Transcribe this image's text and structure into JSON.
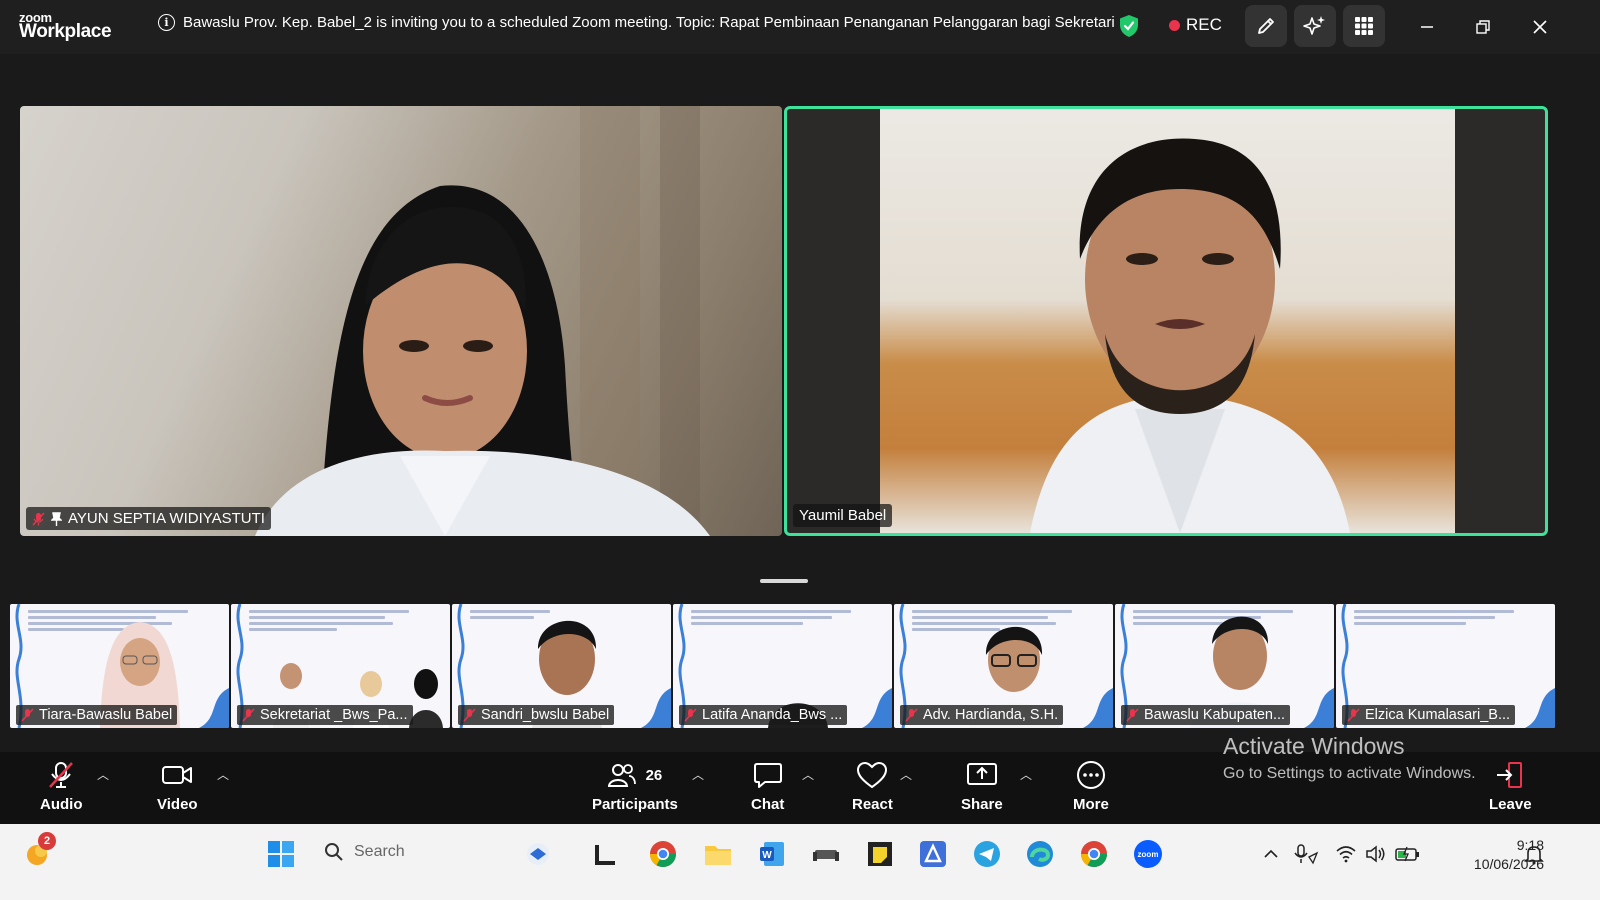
{
  "app": {
    "brand_small": "zoom",
    "brand_big": "Workplace"
  },
  "meeting": {
    "info": "Bawaslu Prov. Kep. Babel_2 is inviting you to a scheduled Zoom meeting.  Topic: Rapat Pembinaan Penanganan Pelanggaran bagi Sekretari",
    "rec_label": "REC"
  },
  "speakers": [
    {
      "name": "AYUN SEPTIA WIDIYASTUTI",
      "muted": true,
      "pinned": true
    },
    {
      "name": "Yaumil Babel",
      "muted": false,
      "pinned": false,
      "active": true
    }
  ],
  "thumbnails": [
    {
      "name": "Tiara-Bawaslu Babel"
    },
    {
      "name": "Sekretariat _Bws_Pa..."
    },
    {
      "name": "Sandri_bwslu Babel"
    },
    {
      "name": "Latifa Ananda_Bws ..."
    },
    {
      "name": "Adv. Hardianda, S.H."
    },
    {
      "name": "Bawaslu Kabupaten..."
    },
    {
      "name": "Elzica Kumalasari_B..."
    }
  ],
  "toolbar": {
    "audio": "Audio",
    "video": "Video",
    "participants": "Participants",
    "participants_count": "26",
    "chat": "Chat",
    "react": "React",
    "share": "Share",
    "more": "More",
    "leave": "Leave"
  },
  "watermark": {
    "line1": "Activate Windows",
    "line2": "Go to Settings to activate Windows."
  },
  "taskbar": {
    "search_placeholder": "Search",
    "time": "9:18",
    "date": "10/06/2026",
    "notification_count": "2"
  },
  "colors": {
    "active_speaker_border": "#3ee29a",
    "rec_dot": "#e8344c",
    "muted_mic": "#e8344c"
  }
}
